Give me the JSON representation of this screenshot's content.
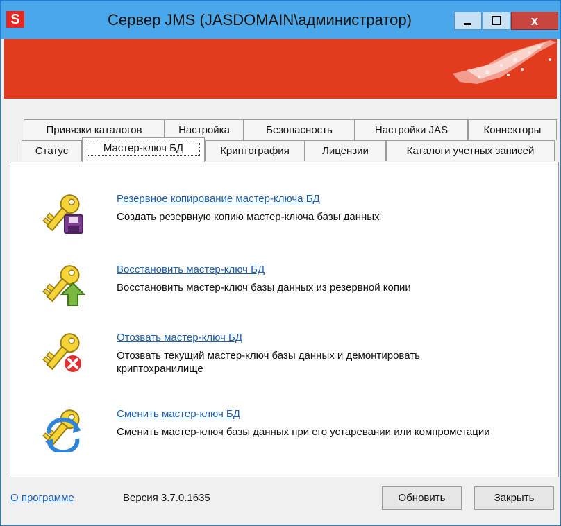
{
  "window": {
    "app_icon_letter": "S",
    "title": "Сервер JMS (JASDOMAIN\\администратор)",
    "close_glyph": "x",
    "accent": "#e23b1e",
    "titlebar_color": "#4aa8ea"
  },
  "tabs": {
    "row1": [
      "Привязки каталогов",
      "Настройка",
      "Безопасность",
      "Настройки JAS",
      "Коннекторы"
    ],
    "row2": [
      "Статус",
      "Мастер-ключ БД",
      "Криптография",
      "Лицензии",
      "Каталоги учетных записей"
    ],
    "active": "Мастер-ключ БД"
  },
  "actions": [
    {
      "icon": "key-floppy-icon",
      "link": "Резервное копирование мастер-ключа БД",
      "desc": "Создать резервную копию мастер-ключа базы данных"
    },
    {
      "icon": "key-up-arrow-icon",
      "link": "Восстановить мастер-ключ БД",
      "desc": "Восстановить мастер-ключ базы данных из резервной копии"
    },
    {
      "icon": "key-revoke-icon",
      "link": "Отозвать мастер-ключ БД",
      "desc": "Отозвать текущий мастер-ключ базы данных и демонтировать криптохранилище"
    },
    {
      "icon": "key-refresh-icon",
      "link": "Сменить мастер-ключ БД",
      "desc": "Сменить мастер-ключ базы данных при его устаревании или компрометации"
    }
  ],
  "footer": {
    "about_link": "О программе",
    "version": "Версия 3.7.0.1635",
    "refresh_button": "Обновить",
    "close_button": "Закрыть"
  }
}
